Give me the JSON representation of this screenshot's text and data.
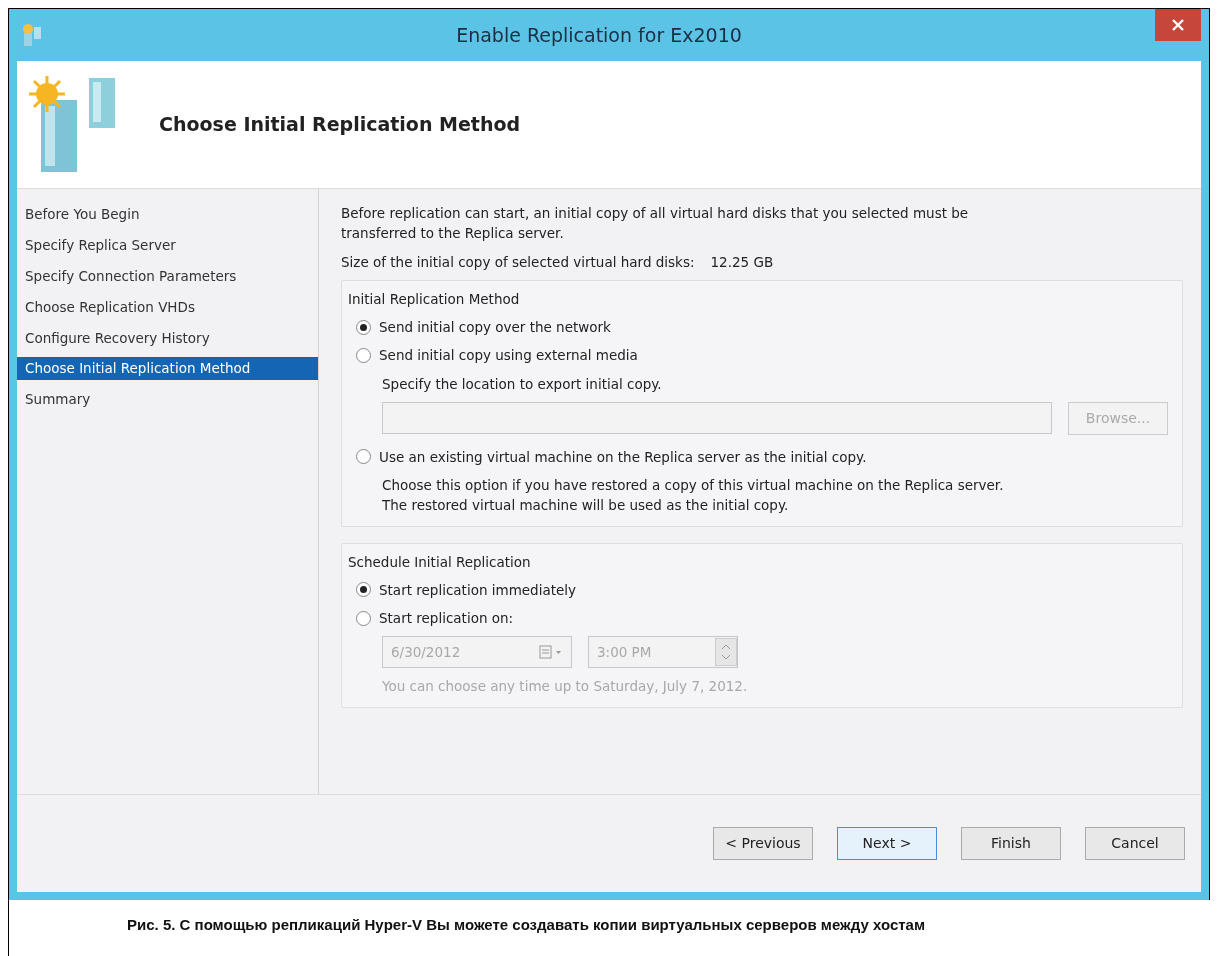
{
  "window": {
    "title": "Enable Replication for Ex2010"
  },
  "header": {
    "title": "Choose Initial Replication Method"
  },
  "steps": [
    {
      "label": "Before You Begin",
      "selected": false
    },
    {
      "label": "Specify Replica Server",
      "selected": false
    },
    {
      "label": "Specify Connection Parameters",
      "selected": false
    },
    {
      "label": "Choose Replication VHDs",
      "selected": false
    },
    {
      "label": "Configure Recovery History",
      "selected": false
    },
    {
      "label": "Choose Initial Replication Method",
      "selected": true
    },
    {
      "label": "Summary",
      "selected": false
    }
  ],
  "intro": "Before replication can start, an initial copy of all virtual hard disks that you selected must be\ntransferred to the Replica server.",
  "size": {
    "label": "Size of the initial copy of selected virtual hard disks:",
    "value": "12.25 GB"
  },
  "method_group": {
    "title": "Initial Replication Method",
    "options": [
      {
        "label": "Send initial copy over the network",
        "selected": true
      },
      {
        "label": "Send initial copy using external media",
        "selected": false,
        "description": "Specify the location to export initial copy.",
        "path_field": {
          "disabled": true
        },
        "browse_button": {
          "label": "Browse...",
          "disabled": true
        }
      },
      {
        "label": "Use an existing virtual machine on the Replica server as the initial copy.",
        "selected": false,
        "description": "Choose this option if you have restored a copy of this virtual machine on the Replica server.\nThe restored virtual machine will be used as the initial copy."
      }
    ]
  },
  "schedule_group": {
    "title": "Schedule Initial Replication",
    "options": [
      {
        "label": "Start replication immediately",
        "selected": true
      },
      {
        "label": "Start replication on:",
        "selected": false
      }
    ],
    "date": {
      "value": "6/30/2012",
      "disabled": true
    },
    "time": {
      "value": "3:00 PM",
      "disabled": true
    },
    "hint": {
      "text": "You can choose any time up to Saturday, July 7, 2012.",
      "disabled": true
    }
  },
  "buttons": [
    {
      "label": "< Previous",
      "default": false
    },
    {
      "label": "Next >",
      "default": true
    },
    {
      "label": "Finish",
      "default": false
    },
    {
      "label": "Cancel",
      "default": false
    }
  ],
  "caption": "Рис. 5. С помощью репликаций Hyper-V Вы можете создавать копии виртуальных серверов между хостам"
}
